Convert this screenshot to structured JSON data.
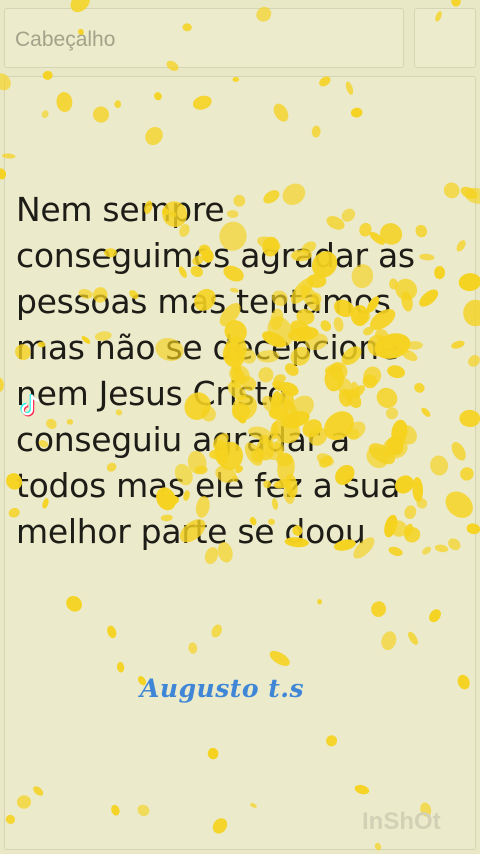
{
  "header": {
    "placeholder": "Cabeçalho"
  },
  "note": {
    "body_text": "Nem sempre\nconseguimos agradar as\npessoas mas tentamos\nmas não se decepcione\nnem Jesus Cristo\nconseguiu agradar a\ntodos mas ele fez a sua\nmelhor parte se doou",
    "signature": "Augusto t.s"
  },
  "overlay": {
    "watermark_text": "InShOt",
    "tiktok_icon": "tiktok-icon",
    "confetti_icon": "gold-confetti"
  },
  "colors": {
    "background": "#e9e8c6",
    "text": "#1d1c16",
    "signature": "#3f86d6",
    "confetti": "#f5d21f"
  }
}
